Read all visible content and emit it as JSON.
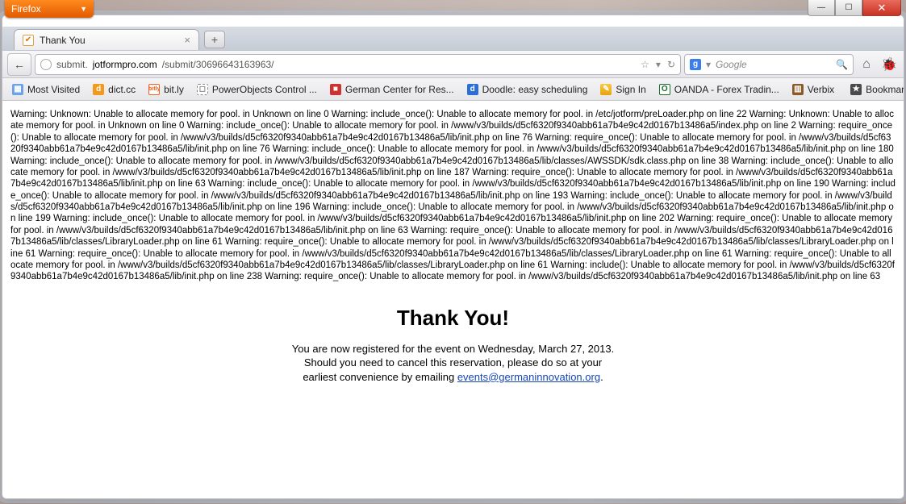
{
  "firefox_menu": {
    "label": "Firefox"
  },
  "win": {
    "min": "—",
    "max": "☐",
    "close": "✕"
  },
  "tab": {
    "title": "Thank You",
    "fav_glyph": "✔",
    "close": "×",
    "newtab": "+"
  },
  "nav": {
    "back": "←",
    "url_prefix": "submit.",
    "url_host": "jotformpro.com",
    "url_path": "/submit/30696643163963/",
    "star": "☆",
    "dropdown": "▾",
    "reload": "↻",
    "home": "⌂"
  },
  "search": {
    "logo": "g",
    "dropdown": "▾",
    "placeholder": "Google",
    "mag": "🔍"
  },
  "toolbar_right": {
    "colorful": "🐞"
  },
  "bookmarks": {
    "mostvisited": {
      "glyph": "▦",
      "label": "Most Visited"
    },
    "dictcc": {
      "glyph": "d",
      "label": "dict.cc"
    },
    "bitly": {
      "glyph": "bitly",
      "label": "bit.ly"
    },
    "powerobjects": {
      "glyph": "◻",
      "label": "PowerObjects Control ..."
    },
    "german": {
      "glyph": "■",
      "label": "German Center for Res..."
    },
    "doodle": {
      "glyph": "d",
      "label": "Doodle: easy scheduling"
    },
    "signin": {
      "glyph": "✎",
      "label": "Sign In"
    },
    "oanda": {
      "glyph": "O",
      "label": "OANDA - Forex Tradin..."
    },
    "verbix": {
      "glyph": "▥",
      "label": "Verbix"
    },
    "bookmarks": {
      "glyph": "★",
      "label": "Bookmarks"
    }
  },
  "page": {
    "warning_text": "Warning: Unknown: Unable to allocate memory for pool. in Unknown on line 0 Warning: include_once(): Unable to allocate memory for pool. in /etc/jotform/preLoader.php on line 22 Warning: Unknown: Unable to allocate memory for pool. in Unknown on line 0 Warning: include_once(): Unable to allocate memory for pool. in /www/v3/builds/d5cf6320f9340abb61a7b4e9c42d0167b13486a5/index.php on line 2 Warning: require_once(): Unable to allocate memory for pool. in /www/v3/builds/d5cf6320f9340abb61a7b4e9c42d0167b13486a5/lib/init.php on line 76 Warning: require_once(): Unable to allocate memory for pool. in /www/v3/builds/d5cf6320f9340abb61a7b4e9c42d0167b13486a5/lib/init.php on line 76 Warning: include_once(): Unable to allocate memory for pool. in /www/v3/builds/d5cf6320f9340abb61a7b4e9c42d0167b13486a5/lib/init.php on line 180 Warning: include_once(): Unable to allocate memory for pool. in /www/v3/builds/d5cf6320f9340abb61a7b4e9c42d0167b13486a5/lib/classes/AWSSDK/sdk.class.php on line 38 Warning: include_once(): Unable to allocate memory for pool. in /www/v3/builds/d5cf6320f9340abb61a7b4e9c42d0167b13486a5/lib/init.php on line 187 Warning: require_once(): Unable to allocate memory for pool. in /www/v3/builds/d5cf6320f9340abb61a7b4e9c42d0167b13486a5/lib/init.php on line 63 Warning: include_once(): Unable to allocate memory for pool. in /www/v3/builds/d5cf6320f9340abb61a7b4e9c42d0167b13486a5/lib/init.php on line 190 Warning: include_once(): Unable to allocate memory for pool. in /www/v3/builds/d5cf6320f9340abb61a7b4e9c42d0167b13486a5/lib/init.php on line 193 Warning: include_once(): Unable to allocate memory for pool. in /www/v3/builds/d5cf6320f9340abb61a7b4e9c42d0167b13486a5/lib/init.php on line 196 Warning: include_once(): Unable to allocate memory for pool. in /www/v3/builds/d5cf6320f9340abb61a7b4e9c42d0167b13486a5/lib/init.php on line 199 Warning: include_once(): Unable to allocate memory for pool. in /www/v3/builds/d5cf6320f9340abb61a7b4e9c42d0167b13486a5/lib/init.php on line 202 Warning: require_once(): Unable to allocate memory for pool. in /www/v3/builds/d5cf6320f9340abb61a7b4e9c42d0167b13486a5/lib/init.php on line 63 Warning: require_once(): Unable to allocate memory for pool. in /www/v3/builds/d5cf6320f9340abb61a7b4e9c42d0167b13486a5/lib/classes/LibraryLoader.php on line 61 Warning: require_once(): Unable to allocate memory for pool. in /www/v3/builds/d5cf6320f9340abb61a7b4e9c42d0167b13486a5/lib/classes/LibraryLoader.php on line 61 Warning: require_once(): Unable to allocate memory for pool. in /www/v3/builds/d5cf6320f9340abb61a7b4e9c42d0167b13486a5/lib/classes/LibraryLoader.php on line 61 Warning: require_once(): Unable to allocate memory for pool. in /www/v3/builds/d5cf6320f9340abb61a7b4e9c42d0167b13486a5/lib/classes/LibraryLoader.php on line 61 Warning: include(): Unable to allocate memory for pool. in /www/v3/builds/d5cf6320f9340abb61a7b4e9c42d0167b13486a5/lib/init.php on line 238 Warning: require_once(): Unable to allocate memory for pool. in /www/v3/builds/d5cf6320f9340abb61a7b4e9c42d0167b13486a5/lib/init.php on line 63",
    "heading": "Thank You!",
    "msg_line1": "You are now registered for the event on Wednesday, March 27, 2013.",
    "msg_line2": "Should you need to cancel this reservation, please do so at your",
    "msg_line3_prefix": "earliest convenience by emailing ",
    "email": "events@germaninnovation.org",
    "msg_line3_suffix": "."
  }
}
